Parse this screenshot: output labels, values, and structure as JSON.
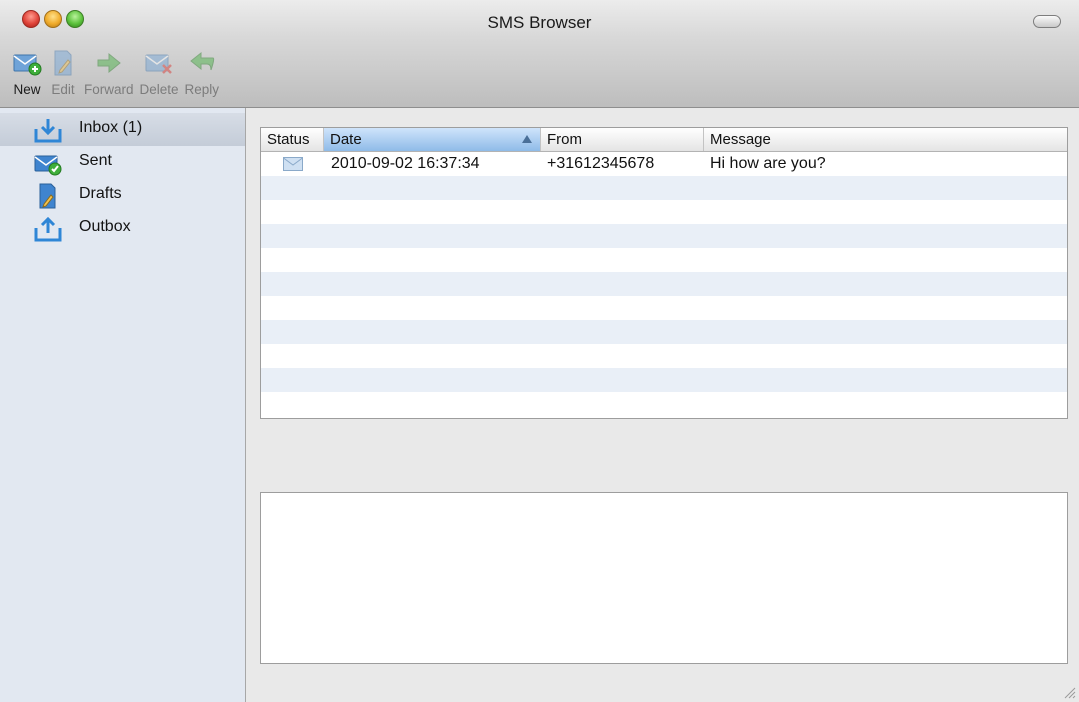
{
  "window": {
    "title": "SMS Browser"
  },
  "toolbar": {
    "buttons": [
      {
        "label": "New",
        "icon": "new-message-icon",
        "enabled": true
      },
      {
        "label": "Edit",
        "icon": "edit-icon",
        "enabled": false
      },
      {
        "label": "Forward",
        "icon": "forward-icon",
        "enabled": false
      },
      {
        "label": "Delete",
        "icon": "delete-icon",
        "enabled": false
      },
      {
        "label": "Reply",
        "icon": "reply-icon",
        "enabled": false
      }
    ]
  },
  "sidebar": {
    "items": [
      {
        "label": "Inbox (1)",
        "icon": "inbox-icon",
        "selected": true
      },
      {
        "label": "Sent",
        "icon": "sent-icon",
        "selected": false
      },
      {
        "label": "Drafts",
        "icon": "drafts-icon",
        "selected": false
      },
      {
        "label": "Outbox",
        "icon": "outbox-icon",
        "selected": false
      }
    ]
  },
  "messages": {
    "columns": [
      "Status",
      "Date",
      "From",
      "Message"
    ],
    "sorted_column": "Date",
    "sort_direction": "ascending",
    "rows": [
      {
        "status_icon": "envelope-icon",
        "date": "2010-09-02 16:37:34",
        "from": "+31612345678",
        "message": "Hi how are you?"
      }
    ]
  },
  "colors": {
    "sidebar_bg": "#e2e8f1",
    "row_stripe": "#e9eff7",
    "sort_header": "#8fbbe8"
  }
}
